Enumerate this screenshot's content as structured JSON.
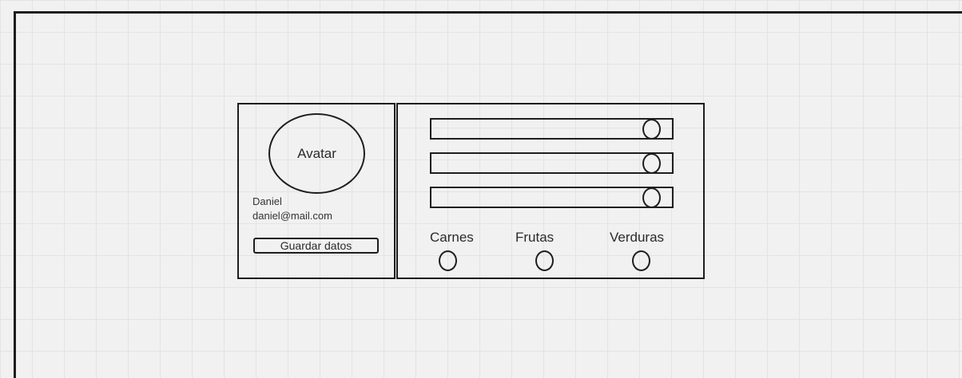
{
  "profile": {
    "avatar_label": "Avatar",
    "name": "Daniel",
    "email": "daniel@mail.com",
    "save_label": "Guardar datos"
  },
  "sliders": [
    {
      "value": 0.9
    },
    {
      "value": 0.9
    },
    {
      "value": 0.9
    }
  ],
  "options": [
    {
      "label": "Carnes"
    },
    {
      "label": "Frutas"
    },
    {
      "label": "Verduras"
    }
  ]
}
